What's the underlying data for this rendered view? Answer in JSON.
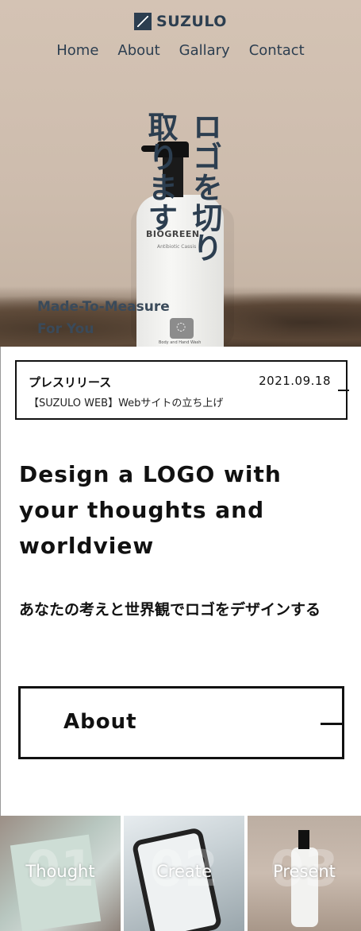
{
  "header": {
    "brand": "SUZULO",
    "nav": [
      "Home",
      "About",
      "Gallary",
      "Contact"
    ]
  },
  "hero": {
    "tagline_right": "ロゴを切り",
    "tagline_left": "取ります",
    "subtitle_line1": "Made-To-Measure",
    "subtitle_line2": "For You",
    "bottle_brand": "BIOGREEN",
    "bottle_sub": "Antibiotic Cassis",
    "bottle_label": "Body and Hand Wash"
  },
  "press": {
    "title": "プレスリリース",
    "date": "2021.09.18",
    "text": "【SUZULO WEB】Webサイトの立ち上げ"
  },
  "design": {
    "headline": "Design a LOGO with your thoughts and worldview",
    "subtitle": "あなたの考えと世界観でロゴをデザインする"
  },
  "about_button": {
    "label": "About"
  },
  "cards": [
    {
      "num": "01",
      "label": "Thought"
    },
    {
      "num": "02",
      "label": "Create"
    },
    {
      "num": "03",
      "label": "Present"
    }
  ],
  "colors": {
    "hero_bg": "#d4c3b4",
    "brand": "#2c3e50",
    "text": "#111111"
  }
}
